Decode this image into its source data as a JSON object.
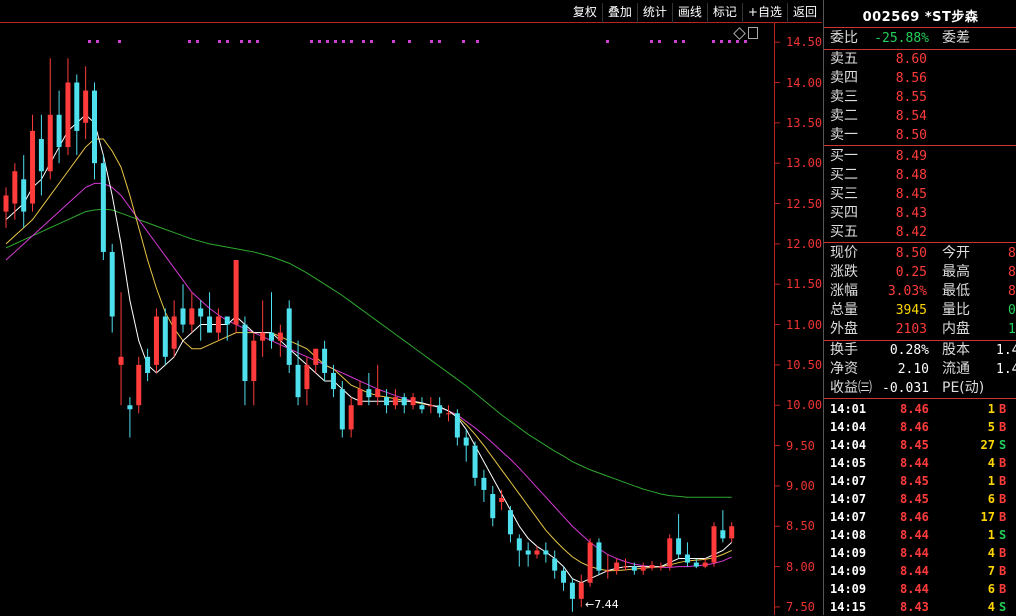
{
  "toolbar": {
    "buttons": [
      "复权",
      "叠加",
      "统计",
      "画线",
      "标记",
      "+自选",
      "返回"
    ]
  },
  "chart": {
    "y_ticks": [
      "14.50",
      "14.00",
      "13.50",
      "13.00",
      "12.50",
      "12.00",
      "11.50",
      "11.00",
      "10.50",
      "10.00",
      "9.50",
      "9.00",
      "8.50",
      "8.00",
      "7.50"
    ],
    "low_marker": "←7.44"
  },
  "chart_data": {
    "type": "candlestick",
    "ylim": [
      7.4,
      14.75
    ],
    "y_ticks": [
      14.5,
      14.0,
      13.5,
      13.0,
      12.5,
      12.0,
      11.5,
      11.0,
      10.5,
      10.0,
      9.5,
      9.0,
      8.5,
      8.0,
      7.5
    ],
    "colors": {
      "up": "#ff3b3b",
      "down": "#4fe0ee",
      "ma5": "#ffffff",
      "ma10": "#e8c547",
      "ma20": "#d63ad6",
      "ma60": "#2ea82e"
    },
    "candles": [
      [
        12.4,
        12.6,
        12.2,
        12.7
      ],
      [
        12.5,
        12.9,
        12.3,
        13.0
      ],
      [
        12.8,
        12.4,
        12.2,
        13.1
      ],
      [
        12.5,
        13.4,
        12.4,
        13.6
      ],
      [
        13.3,
        12.9,
        12.6,
        13.6
      ],
      [
        12.9,
        13.6,
        12.8,
        14.3
      ],
      [
        13.6,
        13.2,
        13.0,
        13.9
      ],
      [
        13.2,
        14.0,
        13.1,
        14.3
      ],
      [
        14.0,
        13.4,
        13.1,
        14.1
      ],
      [
        13.5,
        13.9,
        13.3,
        14.2
      ],
      [
        13.9,
        13.0,
        12.8,
        14.0
      ],
      [
        13.0,
        11.9,
        11.8,
        13.1
      ],
      [
        11.9,
        11.1,
        10.9,
        12.0
      ],
      [
        10.5,
        10.6,
        10.0,
        11.4
      ],
      [
        10.0,
        9.95,
        9.6,
        10.1
      ],
      [
        10.0,
        10.5,
        9.9,
        10.6
      ],
      [
        10.6,
        10.4,
        10.3,
        10.7
      ],
      [
        10.5,
        11.1,
        10.4,
        11.2
      ],
      [
        11.1,
        10.6,
        10.5,
        11.2
      ],
      [
        10.7,
        11.1,
        10.6,
        11.3
      ],
      [
        11.2,
        11.0,
        10.9,
        11.5
      ],
      [
        11.0,
        11.2,
        10.9,
        11.4
      ],
      [
        11.2,
        11.1,
        10.8,
        11.3
      ],
      [
        11.1,
        10.9,
        10.9,
        11.4
      ],
      [
        10.9,
        11.1,
        10.8,
        11.2
      ],
      [
        11.1,
        11.0,
        10.8,
        11.1
      ],
      [
        11.0,
        11.8,
        10.9,
        11.8
      ],
      [
        11.0,
        10.3,
        10.0,
        11.1
      ],
      [
        10.3,
        10.8,
        10.0,
        10.9
      ],
      [
        10.8,
        10.9,
        10.6,
        11.3
      ],
      [
        10.9,
        10.8,
        10.7,
        11.4
      ],
      [
        10.8,
        10.9,
        10.6,
        11.0
      ],
      [
        11.2,
        10.5,
        10.4,
        11.3
      ],
      [
        10.5,
        10.1,
        10.0,
        10.8
      ],
      [
        10.2,
        10.5,
        10.0,
        10.6
      ],
      [
        10.5,
        10.7,
        10.4,
        10.7
      ],
      [
        10.7,
        10.4,
        10.3,
        10.8
      ],
      [
        10.4,
        10.2,
        10.1,
        10.5
      ],
      [
        10.2,
        9.7,
        9.6,
        10.3
      ],
      [
        9.7,
        10.0,
        9.6,
        10.1
      ],
      [
        10.0,
        10.2,
        10.0,
        10.3
      ],
      [
        10.2,
        10.1,
        10.0,
        10.4
      ],
      [
        10.1,
        10.2,
        10.0,
        10.5
      ],
      [
        10.1,
        10.0,
        9.9,
        10.2
      ],
      [
        10.0,
        10.1,
        9.95,
        10.2
      ],
      [
        10.1,
        10.0,
        9.9,
        10.15
      ],
      [
        10.0,
        10.1,
        9.95,
        10.15
      ],
      [
        10.0,
        9.95,
        9.9,
        10.1
      ],
      [
        10.0,
        10.0,
        9.9,
        10.1
      ],
      [
        10.0,
        9.9,
        9.85,
        10.1
      ],
      [
        9.9,
        9.9,
        9.8,
        10.0
      ],
      [
        9.9,
        9.6,
        9.5,
        9.95
      ],
      [
        9.6,
        9.5,
        9.3,
        9.7
      ],
      [
        9.5,
        9.1,
        9.0,
        9.55
      ],
      [
        9.1,
        8.95,
        8.8,
        9.2
      ],
      [
        8.9,
        8.6,
        8.5,
        9.0
      ],
      [
        8.8,
        8.85,
        8.7,
        8.95
      ],
      [
        8.7,
        8.4,
        8.3,
        8.75
      ],
      [
        8.35,
        8.2,
        8.0,
        8.4
      ],
      [
        8.2,
        8.15,
        8.0,
        8.3
      ],
      [
        8.15,
        8.2,
        8.1,
        8.25
      ],
      [
        8.2,
        8.15,
        8.05,
        8.3
      ],
      [
        8.1,
        7.95,
        7.85,
        8.2
      ],
      [
        7.95,
        7.8,
        7.7,
        8.0
      ],
      [
        7.8,
        7.6,
        7.44,
        7.85
      ],
      [
        7.6,
        7.8,
        7.5,
        7.9
      ],
      [
        7.8,
        8.3,
        7.75,
        8.35
      ],
      [
        8.3,
        7.95,
        7.9,
        8.35
      ],
      [
        7.95,
        7.95,
        7.85,
        8.15
      ],
      [
        7.95,
        8.05,
        7.9,
        8.1
      ],
      [
        8.0,
        8.0,
        7.95,
        8.1
      ],
      [
        8.0,
        7.95,
        7.9,
        8.05
      ],
      [
        7.95,
        8.0,
        7.9,
        8.05
      ],
      [
        7.98,
        8.02,
        7.95,
        8.07
      ],
      [
        8.0,
        8.0,
        7.95,
        8.05
      ],
      [
        8.0,
        8.35,
        7.95,
        8.4
      ],
      [
        8.35,
        8.15,
        8.1,
        8.65
      ],
      [
        8.15,
        8.05,
        8.0,
        8.3
      ],
      [
        8.05,
        8.0,
        7.98,
        8.1
      ],
      [
        8.0,
        8.05,
        7.98,
        8.1
      ],
      [
        8.05,
        8.5,
        8.0,
        8.55
      ],
      [
        8.45,
        8.35,
        8.3,
        8.7
      ],
      [
        8.35,
        8.5,
        8.3,
        8.55
      ]
    ],
    "ma5": [
      12.3,
      12.4,
      12.5,
      12.7,
      12.8,
      13.0,
      13.2,
      13.4,
      13.5,
      13.6,
      13.5,
      13.1,
      12.6,
      12.0,
      11.3,
      10.8,
      10.5,
      10.4,
      10.5,
      10.6,
      10.8,
      10.9,
      11.0,
      11.0,
      11.0,
      11.0,
      11.1,
      11.0,
      10.9,
      10.9,
      10.9,
      10.8,
      10.7,
      10.6,
      10.5,
      10.4,
      10.3,
      10.3,
      10.2,
      10.1,
      10.05,
      10.05,
      10.05,
      10.05,
      10.05,
      10.05,
      10.05,
      10.03,
      10.0,
      9.98,
      9.93,
      9.85,
      9.7,
      9.5,
      9.3,
      9.1,
      8.9,
      8.7,
      8.5,
      8.35,
      8.25,
      8.18,
      8.1,
      8.0,
      7.85,
      7.8,
      7.85,
      7.9,
      7.95,
      7.98,
      8.0,
      8.0,
      8.0,
      8.0,
      8.0,
      8.05,
      8.1,
      8.1,
      8.1,
      8.1,
      8.15,
      8.2,
      8.3
    ],
    "ma10": [
      12.0,
      12.1,
      12.2,
      12.3,
      12.45,
      12.6,
      12.75,
      12.9,
      13.05,
      13.2,
      13.3,
      13.3,
      13.15,
      12.95,
      12.6,
      12.2,
      11.8,
      11.45,
      11.15,
      10.95,
      10.8,
      10.7,
      10.7,
      10.75,
      10.8,
      10.85,
      10.9,
      10.9,
      10.9,
      10.9,
      10.9,
      10.85,
      10.8,
      10.75,
      10.7,
      10.6,
      10.5,
      10.45,
      10.35,
      10.25,
      10.2,
      10.15,
      10.12,
      10.1,
      10.08,
      10.06,
      10.04,
      10.02,
      10.0,
      9.98,
      9.93,
      9.86,
      9.76,
      9.64,
      9.5,
      9.35,
      9.2,
      9.05,
      8.9,
      8.75,
      8.6,
      8.45,
      8.33,
      8.22,
      8.12,
      8.05,
      8.0,
      7.97,
      7.95,
      7.95,
      7.96,
      7.97,
      7.98,
      7.99,
      8.0,
      8.02,
      8.05,
      8.07,
      8.08,
      8.09,
      8.11,
      8.15,
      8.2
    ],
    "ma20": [
      11.8,
      11.9,
      12.0,
      12.1,
      12.2,
      12.3,
      12.4,
      12.5,
      12.6,
      12.7,
      12.75,
      12.75,
      12.7,
      12.6,
      12.45,
      12.3,
      12.15,
      12.0,
      11.85,
      11.7,
      11.55,
      11.4,
      11.3,
      11.2,
      11.12,
      11.05,
      11.0,
      10.95,
      10.9,
      10.85,
      10.8,
      10.75,
      10.7,
      10.65,
      10.6,
      10.55,
      10.5,
      10.45,
      10.4,
      10.35,
      10.3,
      10.25,
      10.2,
      10.16,
      10.12,
      10.08,
      10.05,
      10.02,
      10.0,
      9.97,
      9.93,
      9.88,
      9.8,
      9.72,
      9.63,
      9.53,
      9.43,
      9.33,
      9.22,
      9.1,
      8.98,
      8.86,
      8.74,
      8.62,
      8.5,
      8.4,
      8.3,
      8.22,
      8.15,
      8.1,
      8.06,
      8.03,
      8.01,
      8.0,
      7.99,
      7.99,
      8.0,
      8.0,
      8.01,
      8.02,
      8.04,
      8.07,
      8.12
    ],
    "ma60": [
      11.95,
      12.0,
      12.05,
      12.1,
      12.15,
      12.2,
      12.25,
      12.3,
      12.35,
      12.4,
      12.42,
      12.43,
      12.42,
      12.38,
      12.34,
      12.3,
      12.26,
      12.22,
      12.18,
      12.14,
      12.1,
      12.06,
      12.03,
      12.0,
      11.98,
      11.96,
      11.94,
      11.92,
      11.9,
      11.87,
      11.84,
      11.8,
      11.76,
      11.7,
      11.64,
      11.57,
      11.5,
      11.43,
      11.36,
      11.28,
      11.2,
      11.12,
      11.04,
      10.96,
      10.88,
      10.8,
      10.72,
      10.64,
      10.56,
      10.48,
      10.4,
      10.32,
      10.24,
      10.15,
      10.06,
      9.97,
      9.88,
      9.8,
      9.72,
      9.64,
      9.57,
      9.5,
      9.43,
      9.37,
      9.3,
      9.25,
      9.2,
      9.16,
      9.12,
      9.08,
      9.04,
      9.0,
      8.96,
      8.93,
      8.9,
      8.88,
      8.87,
      8.86,
      8.86,
      8.86,
      8.86,
      8.86,
      8.86
    ]
  },
  "panel": {
    "title": "002569 *ST步森",
    "weibi": {
      "label": "委比",
      "value": "-25.88%",
      "label2": "委差"
    },
    "sells": [
      {
        "label": "卖五",
        "price": "8.60"
      },
      {
        "label": "卖四",
        "price": "8.56"
      },
      {
        "label": "卖三",
        "price": "8.55"
      },
      {
        "label": "卖二",
        "price": "8.54"
      },
      {
        "label": "卖一",
        "price": "8.50"
      }
    ],
    "buys": [
      {
        "label": "买一",
        "price": "8.49"
      },
      {
        "label": "买二",
        "price": "8.48"
      },
      {
        "label": "买三",
        "price": "8.45"
      },
      {
        "label": "买四",
        "price": "8.43"
      },
      {
        "label": "买五",
        "price": "8.42"
      }
    ],
    "stats": [
      {
        "l1": "现价",
        "v1": "8.50",
        "c1": "red",
        "l2": "今开",
        "v2": "8",
        "c2": "red"
      },
      {
        "l1": "涨跌",
        "v1": "0.25",
        "c1": "red",
        "l2": "最高",
        "v2": "8",
        "c2": "red"
      },
      {
        "l1": "涨幅",
        "v1": "3.03%",
        "c1": "red",
        "l2": "最低",
        "v2": "8",
        "c2": "red"
      },
      {
        "l1": "总量",
        "v1": "3945",
        "c1": "yellow",
        "l2": "量比",
        "v2": "0",
        "c2": "green"
      },
      {
        "l1": "外盘",
        "v1": "2103",
        "c1": "red",
        "l2": "内盘",
        "v2": "1",
        "c2": "green"
      }
    ],
    "info": [
      {
        "l1": "换手",
        "v1": "0.28%",
        "l2": "股本",
        "v2": "1.4"
      },
      {
        "l1": "净资",
        "v1": "2.10",
        "l2": "流通",
        "v2": "1.4"
      },
      {
        "l1": "收益㈢",
        "v1": "-0.031",
        "l2": "PE(动)",
        "v2": ""
      }
    ],
    "trades": [
      {
        "time": "14:01",
        "price": "8.46",
        "vol": "1",
        "bs": "B",
        "pc": "red",
        "vc": "yellow"
      },
      {
        "time": "14:04",
        "price": "8.46",
        "vol": "5",
        "bs": "B",
        "pc": "red",
        "vc": "yellow"
      },
      {
        "time": "14:04",
        "price": "8.45",
        "vol": "27",
        "bs": "S",
        "pc": "red",
        "vc": "yellow"
      },
      {
        "time": "14:05",
        "price": "8.44",
        "vol": "4",
        "bs": "B",
        "pc": "red",
        "vc": "yellow"
      },
      {
        "time": "14:07",
        "price": "8.45",
        "vol": "1",
        "bs": "B",
        "pc": "red",
        "vc": "yellow"
      },
      {
        "time": "14:07",
        "price": "8.45",
        "vol": "6",
        "bs": "B",
        "pc": "red",
        "vc": "yellow"
      },
      {
        "time": "14:07",
        "price": "8.46",
        "vol": "17",
        "bs": "B",
        "pc": "red",
        "vc": "yellow"
      },
      {
        "time": "14:08",
        "price": "8.44",
        "vol": "1",
        "bs": "S",
        "pc": "red",
        "vc": "yellow"
      },
      {
        "time": "14:09",
        "price": "8.44",
        "vol": "4",
        "bs": "B",
        "pc": "red",
        "vc": "yellow"
      },
      {
        "time": "14:09",
        "price": "8.44",
        "vol": "7",
        "bs": "B",
        "pc": "red",
        "vc": "yellow"
      },
      {
        "time": "14:09",
        "price": "8.44",
        "vol": "6",
        "bs": "B",
        "pc": "red",
        "vc": "yellow"
      },
      {
        "time": "14:15",
        "price": "8.43",
        "vol": "4",
        "bs": "S",
        "pc": "red",
        "vc": "yellow"
      }
    ]
  }
}
